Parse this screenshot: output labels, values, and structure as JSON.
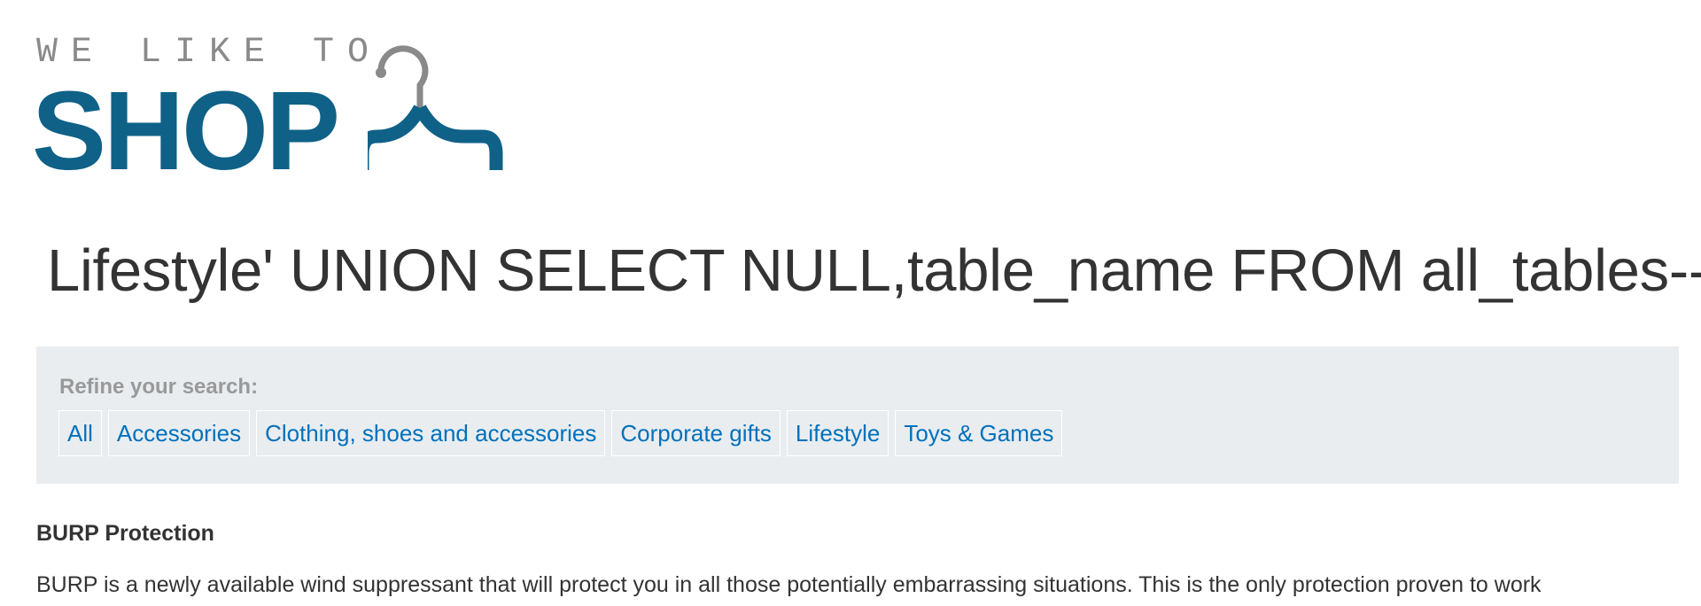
{
  "logo": {
    "tagline": "WE LIKE TO",
    "word": "SHOP",
    "icon": "hanger-icon"
  },
  "heading": "Lifestyle' UNION SELECT NULL,table_name FROM all_tables--",
  "filter": {
    "label": "Refine your search:",
    "links": [
      "All",
      "Accessories",
      "Clothing, shoes and accessories",
      "Corporate gifts",
      "Lifestyle",
      "Toys & Games"
    ]
  },
  "product": {
    "name": "BURP Protection",
    "description": "BURP is a newly available wind suppressant that will protect you in all those potentially embarrassing situations. This is the only protection proven to work"
  },
  "colors": {
    "brand": "#0f6187",
    "link": "#0071bc",
    "filter_bg": "#e9edf0"
  }
}
